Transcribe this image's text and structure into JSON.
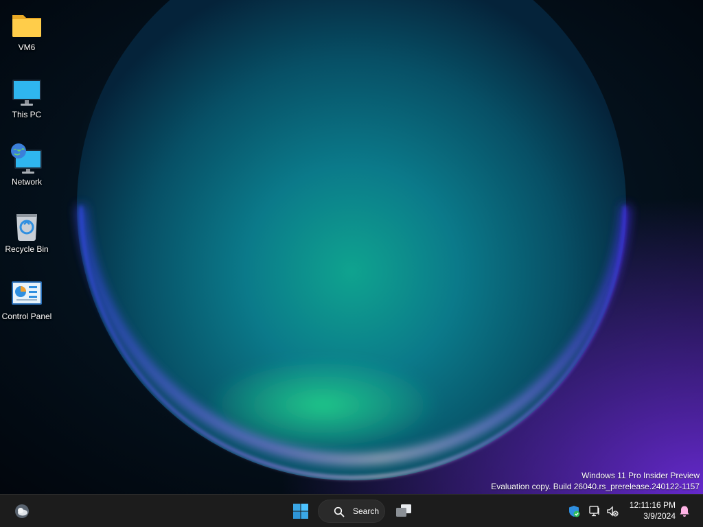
{
  "desktop": {
    "icons": [
      {
        "label": "VM6",
        "icon": "folder-icon"
      },
      {
        "label": "This PC",
        "icon": "monitor-icon"
      },
      {
        "label": "Network",
        "icon": "network-icon"
      },
      {
        "label": "Recycle Bin",
        "icon": "recycle-bin-icon"
      },
      {
        "label": "Control Panel",
        "icon": "control-panel-icon"
      }
    ],
    "watermark": {
      "line1": "Windows 11 Pro Insider Preview",
      "line2": "Evaluation copy. Build 26040.rs_prerelease.240122-1157"
    }
  },
  "taskbar": {
    "search_label": "Search",
    "clock": {
      "time": "12:11:16 PM",
      "date": "3/9/2024"
    },
    "accent_color": "#3aa7e6"
  }
}
